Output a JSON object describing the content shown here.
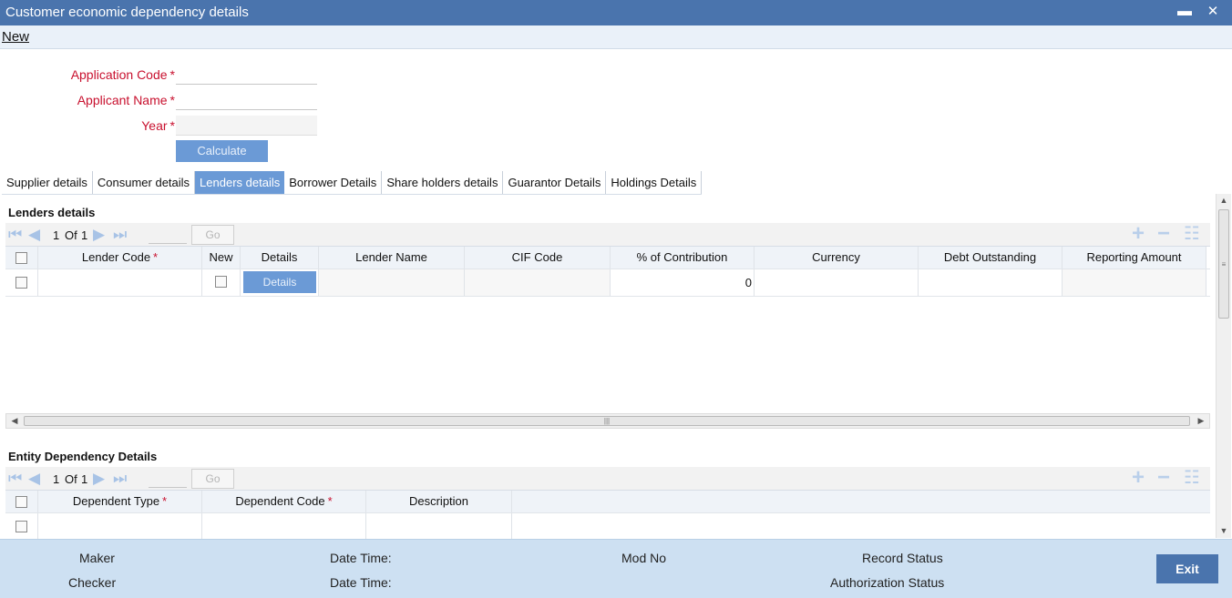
{
  "window": {
    "title": "Customer economic dependency details",
    "minimize_glyph": "▬",
    "close_glyph": "✕"
  },
  "menu": {
    "new_label": "New"
  },
  "form": {
    "application_code": {
      "label": "Application Code",
      "value": ""
    },
    "applicant_name": {
      "label": "Applicant Name",
      "value": ""
    },
    "year": {
      "label": "Year",
      "value": ""
    },
    "required_mark": "*",
    "calculate_label": "Calculate"
  },
  "tabs": [
    {
      "label": "Supplier details",
      "active": false
    },
    {
      "label": "Consumer details",
      "active": false
    },
    {
      "label": "Lenders details",
      "active": true
    },
    {
      "label": "Borrower Details",
      "active": false
    },
    {
      "label": "Share holders details",
      "active": false
    },
    {
      "label": "Guarantor Details",
      "active": false
    },
    {
      "label": "Holdings Details",
      "active": false
    }
  ],
  "lenders": {
    "title": "Lenders details",
    "pager": {
      "current": "1",
      "of_label": "Of",
      "total": "1",
      "go_label": "Go"
    },
    "columns": [
      "Lender Code",
      "New",
      "Details",
      "Lender Name",
      "CIF Code",
      "% of Contribution",
      "Currency",
      "Debt Outstanding",
      "Reporting Amount"
    ],
    "rows": [
      {
        "lender_code": "",
        "details_label": "Details",
        "lender_name": "",
        "cif_code": "",
        "contribution": "0",
        "currency": "",
        "debt_outstanding": "",
        "reporting_amount": ""
      }
    ]
  },
  "entity": {
    "title": "Entity Dependency Details",
    "pager": {
      "current": "1",
      "of_label": "Of",
      "total": "1",
      "go_label": "Go"
    },
    "columns": [
      "Dependent Type",
      "Dependent Code",
      "Description"
    ],
    "rows": [
      {
        "dependent_type": "",
        "dependent_code": "",
        "description": ""
      }
    ]
  },
  "footer": {
    "maker": "Maker",
    "checker": "Checker",
    "date_time_1": "Date Time:",
    "date_time_2": "Date Time:",
    "mod_no": "Mod No",
    "record_status": "Record Status",
    "authorization_status": "Authorization Status",
    "exit_label": "Exit"
  },
  "icons": {
    "first": "first-page-icon",
    "prev": "previous-page-icon",
    "next": "next-page-icon",
    "last": "last-page-icon",
    "add": "add-row-icon",
    "delete": "delete-row-icon",
    "view": "single-view-icon"
  },
  "colors": {
    "titlebar": "#4a74ad",
    "button": "#6b9ad6",
    "required": "#c8102e",
    "footer": "#cde0f2"
  }
}
